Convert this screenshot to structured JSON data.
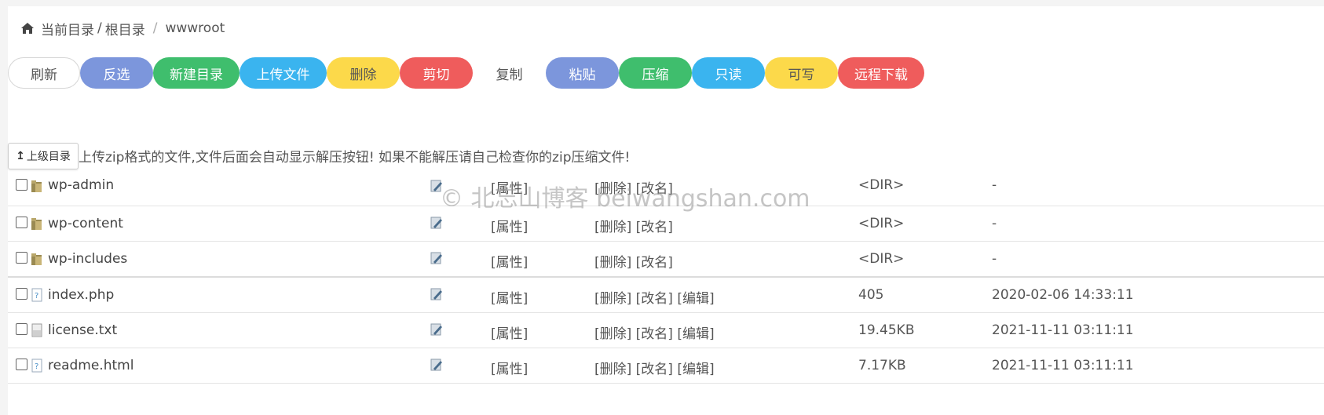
{
  "breadcrumb": {
    "current_label": "当前目录",
    "separator1": "/",
    "root_label": "根目录",
    "separator2": "/",
    "folder": "wwwroot"
  },
  "toolbar": {
    "buttons": [
      {
        "label": "刷新",
        "color": "#ffffff"
      },
      {
        "label": "反选",
        "color": "#7c96dc"
      },
      {
        "label": "新建目录",
        "color": "#3fbe6d"
      },
      {
        "label": "上传文件",
        "color": "#3ab4ef"
      },
      {
        "label": "删除",
        "color": "#fcd94a"
      },
      {
        "label": "剪切",
        "color": "#ef5c5c"
      },
      {
        "label": "复制",
        "color": "#ffffff"
      },
      {
        "label": "粘贴",
        "color": "#7c96dc"
      },
      {
        "label": "压缩",
        "color": "#3fbe6d"
      },
      {
        "label": "只读",
        "color": "#3ab4ef"
      },
      {
        "label": "可写",
        "color": "#fcd94a"
      },
      {
        "label": "远程下载",
        "color": "#ef5c5c"
      }
    ]
  },
  "up_button": {
    "arrow": "↥",
    "label": "上级目录"
  },
  "notice": "上传zip格式的文件,文件后面会自动显示解压按钮! 如果不能解压请自己检查你的zip压缩文件!",
  "watermark": "© 北忘山博客 beiwangshan.com",
  "files": [
    {
      "name": "wp-admin",
      "icon": "folder-icon",
      "attr": "[属性]",
      "delete": "[删除]",
      "rename": "[改名]",
      "edit": "",
      "size": "<DIR>",
      "date": "-"
    },
    {
      "name": "wp-content",
      "icon": "folder-icon",
      "attr": "[属性]",
      "delete": "[删除]",
      "rename": "[改名]",
      "edit": "",
      "size": "<DIR>",
      "date": "-"
    },
    {
      "name": "wp-includes",
      "icon": "folder-icon",
      "attr": "[属性]",
      "delete": "[删除]",
      "rename": "[改名]",
      "edit": "",
      "size": "<DIR>",
      "date": "-"
    },
    {
      "name": "index.php",
      "icon": "unknown-file-icon",
      "attr": "[属性]",
      "delete": "[删除]",
      "rename": "[改名]",
      "edit": "[编辑]",
      "size": "405",
      "date": "2020-02-06 14:33:11"
    },
    {
      "name": "license.txt",
      "icon": "text-file-icon",
      "attr": "[属性]",
      "delete": "[删除]",
      "rename": "[改名]",
      "edit": "[编辑]",
      "size": "19.45KB",
      "date": "2021-11-11 03:11:11"
    },
    {
      "name": "readme.html",
      "icon": "unknown-file-icon",
      "attr": "[属性]",
      "delete": "[删除]",
      "rename": "[改名]",
      "edit": "[编辑]",
      "size": "7.17KB",
      "date": "2021-11-11 03:11:11"
    }
  ]
}
